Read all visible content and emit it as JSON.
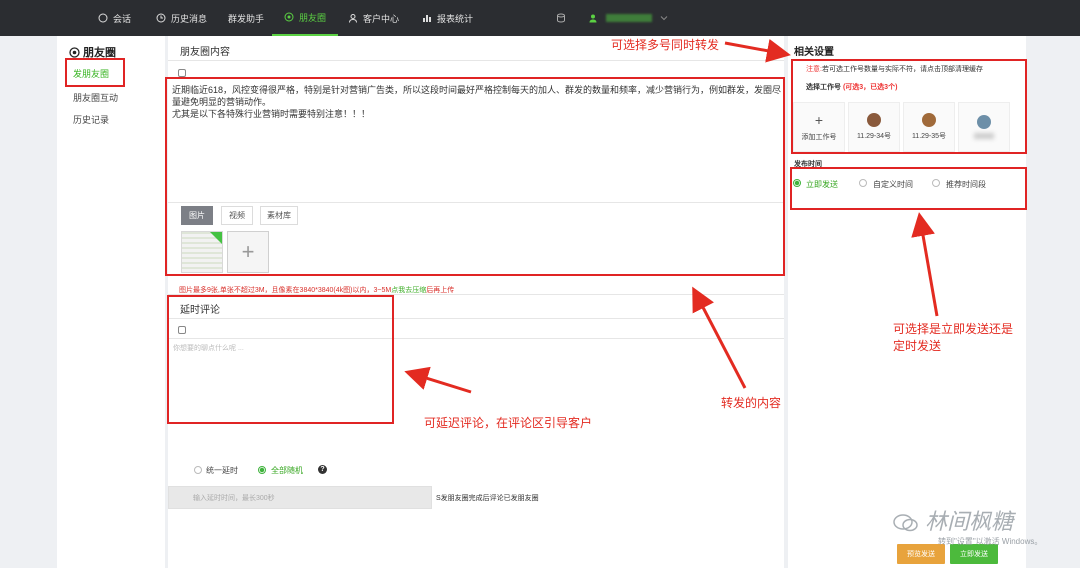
{
  "topnav": {
    "items": [
      {
        "label": "会话",
        "icon": "chat-icon"
      },
      {
        "label": "历史消息",
        "icon": "clock-icon"
      },
      {
        "label": "群发助手",
        "icon": ""
      },
      {
        "label": "朋友圈",
        "icon": "moments-icon"
      },
      {
        "label": "客户中心",
        "icon": "user-icon"
      },
      {
        "label": "报表统计",
        "icon": "bar-chart-icon"
      }
    ],
    "active_index": 3,
    "account_icon": "database-icon",
    "user_icon": "user-icon"
  },
  "sidebar": {
    "title": "朋友圈",
    "items": [
      {
        "label": "发朋友圈",
        "active": true
      },
      {
        "label": "朋友圈互动",
        "active": false
      },
      {
        "label": "历史记录",
        "active": false
      }
    ]
  },
  "main": {
    "content_title": "朋友圈内容",
    "content_lines": [
      "近期临近618，风控变得很严格，特别是针对营销广告类，所以这段时间最好严格控制每天的加人、群发的数量和频率，减少营销行为，例如群发，发圈尽量避免明显的营销动作。",
      "尤其是以下各特殊行业营销时需要特别注意！！！"
    ],
    "media_tabs": [
      "图片",
      "视频",
      "素材库"
    ],
    "image_hint": "图片最多9张,单张不超过3M，且像素在3840*3840(4k图)以内，3~5M点我去压缩后再上传",
    "image_hint_link": "点我去压缩",
    "delay_title": "延时评论",
    "delay_placeholder": "你想要的聊点什么呢 ...",
    "delay_options": [
      {
        "label": "统一延时",
        "checked": false
      },
      {
        "label": "全部随机",
        "checked": true
      }
    ],
    "delay_input_placeholder": "输入延时时间，最长300秒",
    "delay_note": "S发朋友圈完成后评论已发朋友圈"
  },
  "right": {
    "title": "相关设置",
    "notice_prefix": "注意:",
    "notice_text": "若可选工作号数量与实际不符，请点击顶部清理缓存",
    "select_label": "选择工作号",
    "select_count": "(可选3，已选3个)",
    "accounts": [
      {
        "label": "添加工作号",
        "type": "add"
      },
      {
        "label": "11.29-34号",
        "type": "avatar",
        "color": "#8a5a3c"
      },
      {
        "label": "11.29-35号",
        "type": "avatar",
        "color": "#a06a3a"
      },
      {
        "label": "",
        "type": "avatar",
        "color": "#6d8fa8"
      }
    ],
    "time_title": "发布时间",
    "time_options": [
      {
        "label": "立即发送",
        "checked": true
      },
      {
        "label": "自定义时间",
        "checked": false
      },
      {
        "label": "推荐时间段",
        "checked": false
      }
    ],
    "btn_preview": "预览发送",
    "btn_send": "立即发送",
    "colors": {
      "preview": "#e8a33c",
      "send": "#4cba3c"
    }
  },
  "annotations": {
    "multi_account": "可选择多号同时转发",
    "send_mode_line1": "可选择是立即发送还是",
    "send_mode_line2": "定时发送",
    "forward_content": "转发的内容",
    "delay_comment": "可延迟评论，在评论区引导客户"
  },
  "watermark": {
    "text": "林间枫糖",
    "windows_note": "转到\"设置\"以激活 Windows。"
  }
}
